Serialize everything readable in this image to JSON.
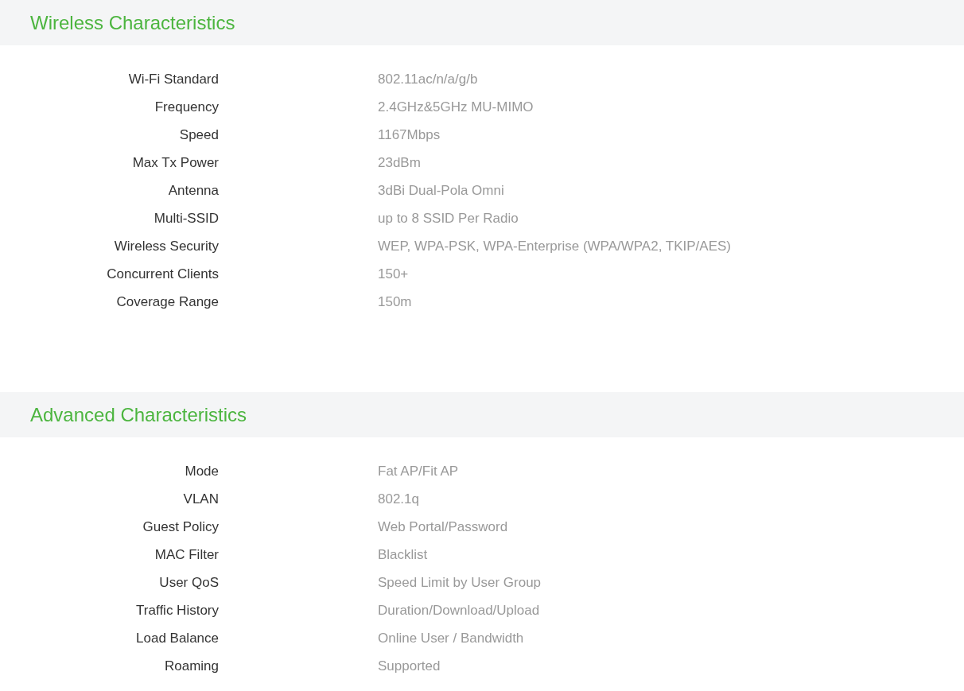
{
  "sections": [
    {
      "title": "Wireless Characteristics",
      "rows": [
        {
          "label": "Wi-Fi Standard",
          "value": "802.11ac/n/a/g/b"
        },
        {
          "label": "Frequency",
          "value": "2.4GHz&5GHz MU-MIMO"
        },
        {
          "label": "Speed",
          "value": "1167Mbps"
        },
        {
          "label": "Max Tx Power",
          "value": "23dBm"
        },
        {
          "label": "Antenna",
          "value": "3dBi Dual-Pola Omni"
        },
        {
          "label": "Multi-SSID",
          "value": "up to 8 SSID Per Radio"
        },
        {
          "label": "Wireless Security",
          "value": "WEP, WPA-PSK, WPA-Enterprise (WPA/WPA2, TKIP/AES)"
        },
        {
          "label": "Concurrent Clients",
          "value": "150+"
        },
        {
          "label": "Coverage Range",
          "value": "150m"
        }
      ]
    },
    {
      "title": "Advanced Characteristics",
      "rows": [
        {
          "label": "Mode",
          "value": "Fat AP/Fit AP"
        },
        {
          "label": "VLAN",
          "value": "802.1q"
        },
        {
          "label": "Guest Policy",
          "value": "Web Portal/Password"
        },
        {
          "label": "MAC Filter",
          "value": "Blacklist"
        },
        {
          "label": "User QoS",
          "value": "Speed Limit by User Group"
        },
        {
          "label": "Traffic History",
          "value": "Duration/Download/Upload"
        },
        {
          "label": "Load Balance",
          "value": "Online User / Bandwidth"
        },
        {
          "label": "Roaming",
          "value": "Supported"
        }
      ]
    }
  ]
}
